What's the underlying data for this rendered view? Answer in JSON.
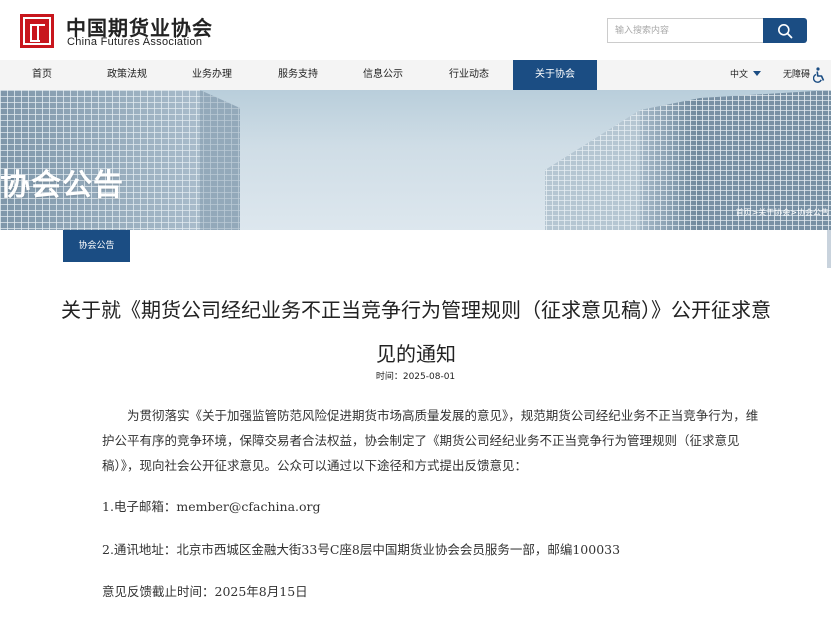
{
  "header": {
    "logo_cn": "中国期货业协会",
    "logo_en": "China Futures Association",
    "search_placeholder": "输入搜索内容"
  },
  "nav": {
    "items": [
      "首页",
      "政策法规",
      "业务办理",
      "服务支持",
      "信息公示",
      "行业动态",
      "关于协会"
    ],
    "active_index": 6,
    "language": "中文",
    "accessibility": "无障碍"
  },
  "banner": {
    "title": "协会公告",
    "breadcrumb": "首页>关于协会>协会公告"
  },
  "section_tag": "协会公告",
  "article": {
    "title": "关于就《期货公司经纪业务不正当竞争行为管理规则（征求意见稿）》公开征求意见的通知",
    "date": "时间：2025-08-01",
    "paragraphs": [
      "为贯彻落实《关于加强监管防范风险促进期货市场高质量发展的意见》，规范期货公司经纪业务不正当竞争行为，维护公平有序的竞争环境，保障交易者合法权益，协会制定了《期货公司经纪业务不正当竞争行为管理规则（征求意见稿）》，现向社会公开征求意见。公众可以通过以下途径和方式提出反馈意见：",
      "1.电子邮箱：member@cfachina.org",
      "2.通讯地址：北京市西城区金融大街33号C座8层中国期货业协会会员服务一部，邮编100033",
      "意见反馈截止时间：2025年8月15日"
    ]
  },
  "colors": {
    "brand_red": "#c8161d",
    "nav_blue": "#1b4d83"
  }
}
